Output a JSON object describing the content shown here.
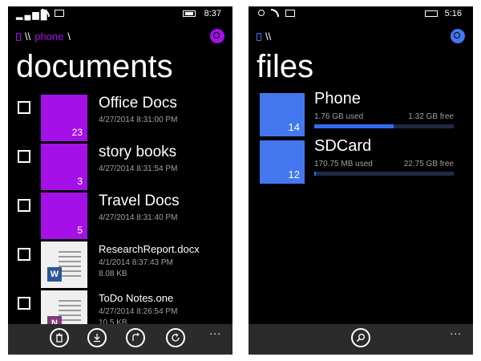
{
  "colors": {
    "accent_purple": "#a510e8",
    "accent_blue": "#4477ee",
    "bar_fill": "#2f6ef0",
    "appbar": "#2b2b2b"
  },
  "left": {
    "status": {
      "signal": "▂▄▆█",
      "time": "8:37"
    },
    "breadcrumb": {
      "root": "\\\\",
      "current": "phone",
      "trail": "\\"
    },
    "title": "documents",
    "folders": [
      {
        "name": "Office Docs",
        "date": "4/27/2014 8:31:00 PM",
        "count": "23"
      },
      {
        "name": "story books",
        "date": "4/27/2014 8:31:54 PM",
        "count": "3"
      },
      {
        "name": "Travel Docs",
        "date": "4/27/2014 8:31:40 PM",
        "count": "5"
      }
    ],
    "files": [
      {
        "name": "ResearchReport.docx",
        "date": "4/1/2014 8:37:43 PM",
        "size": "8.08 KB",
        "badge": "W",
        "badge_color": "#2b5797"
      },
      {
        "name": "ToDo Notes.one",
        "date": "4/27/2014 8:26:54 PM",
        "size": "10.5 KB",
        "badge": "N",
        "badge_color": "#80397b"
      }
    ],
    "appbar": {
      "icons": [
        "delete-icon",
        "download-icon",
        "share-icon",
        "refresh-icon"
      ],
      "more": "..."
    }
  },
  "right": {
    "status": {
      "time": "5:16"
    },
    "breadcrumb": {
      "root": "\\\\"
    },
    "title": "files",
    "drives": [
      {
        "name": "Phone",
        "count": "14",
        "used": "1.76 GB used",
        "free": "1.32 GB free",
        "fill": 0.57
      },
      {
        "name": "SDCard",
        "count": "12",
        "used": "170.75 MB used",
        "free": "22.75 GB free",
        "fill": 0.01
      }
    ],
    "appbar": {
      "icons": [
        "search-icon"
      ],
      "more": "..."
    }
  }
}
